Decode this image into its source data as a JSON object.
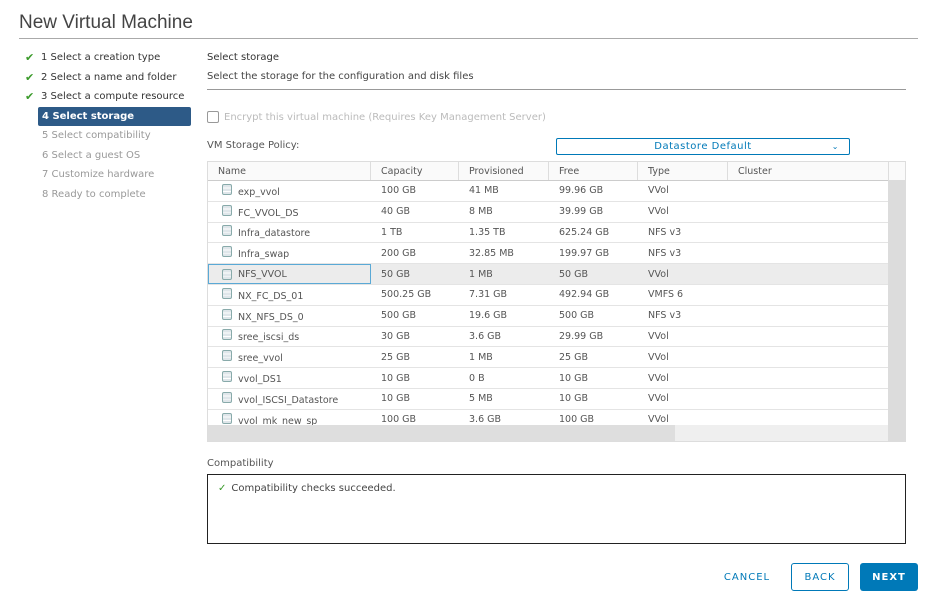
{
  "window": {
    "title": "New Virtual Machine"
  },
  "steps": [
    {
      "label": "1 Select a creation type",
      "state": "done"
    },
    {
      "label": "2 Select a name and folder",
      "state": "done"
    },
    {
      "label": "3 Select a compute resource",
      "state": "done"
    },
    {
      "label": "4 Select storage",
      "state": "active"
    },
    {
      "label": "5 Select compatibility",
      "state": "todo"
    },
    {
      "label": "6 Select a guest OS",
      "state": "todo"
    },
    {
      "label": "7 Customize hardware",
      "state": "todo"
    },
    {
      "label": "8 Ready to complete",
      "state": "todo"
    }
  ],
  "main": {
    "heading": "Select storage",
    "subheading": "Select the storage for the configuration and disk files",
    "encrypt_label": "Encrypt this virtual machine (Requires Key Management Server)",
    "encrypt_checked": false,
    "policy_label": "VM Storage Policy:",
    "policy_value": "Datastore Default"
  },
  "table": {
    "columns": [
      "Name",
      "Capacity",
      "Provisioned",
      "Free",
      "Type",
      "Cluster"
    ],
    "selected": "NFS_VVOL",
    "rows": [
      [
        "exp_vvol",
        "100 GB",
        "41 MB",
        "99.96 GB",
        "VVol",
        ""
      ],
      [
        "FC_VVOL_DS",
        "40 GB",
        "8 MB",
        "39.99 GB",
        "VVol",
        ""
      ],
      [
        "Infra_datastore",
        "1 TB",
        "1.35 TB",
        "625.24 GB",
        "NFS v3",
        ""
      ],
      [
        "Infra_swap",
        "200 GB",
        "32.85 MB",
        "199.97 GB",
        "NFS v3",
        ""
      ],
      [
        "NFS_VVOL",
        "50 GB",
        "1 MB",
        "50 GB",
        "VVol",
        ""
      ],
      [
        "NX_FC_DS_01",
        "500.25 GB",
        "7.31 GB",
        "492.94 GB",
        "VMFS 6",
        ""
      ],
      [
        "NX_NFS_DS_0",
        "500 GB",
        "19.6 GB",
        "500 GB",
        "NFS v3",
        ""
      ],
      [
        "sree_iscsi_ds",
        "30 GB",
        "3.6 GB",
        "29.99 GB",
        "VVol",
        ""
      ],
      [
        "sree_vvol",
        "25 GB",
        "1 MB",
        "25 GB",
        "VVol",
        ""
      ],
      [
        "vvol_DS1",
        "10 GB",
        "0 B",
        "10 GB",
        "VVol",
        ""
      ],
      [
        "vvol_ISCSI_Datastore",
        "10 GB",
        "5 MB",
        "10 GB",
        "VVol",
        ""
      ],
      [
        "vvol_mk_new_sp",
        "100 GB",
        "3.6 GB",
        "100 GB",
        "VVol",
        ""
      ]
    ]
  },
  "compatibility": {
    "label": "Compatibility",
    "message": "Compatibility checks succeeded."
  },
  "buttons": {
    "cancel": "CANCEL",
    "back": "BACK",
    "next": "NEXT"
  },
  "colors": {
    "accent": "#0079b8",
    "active_step": "#2d5a87",
    "success": "#3a9a2a"
  }
}
